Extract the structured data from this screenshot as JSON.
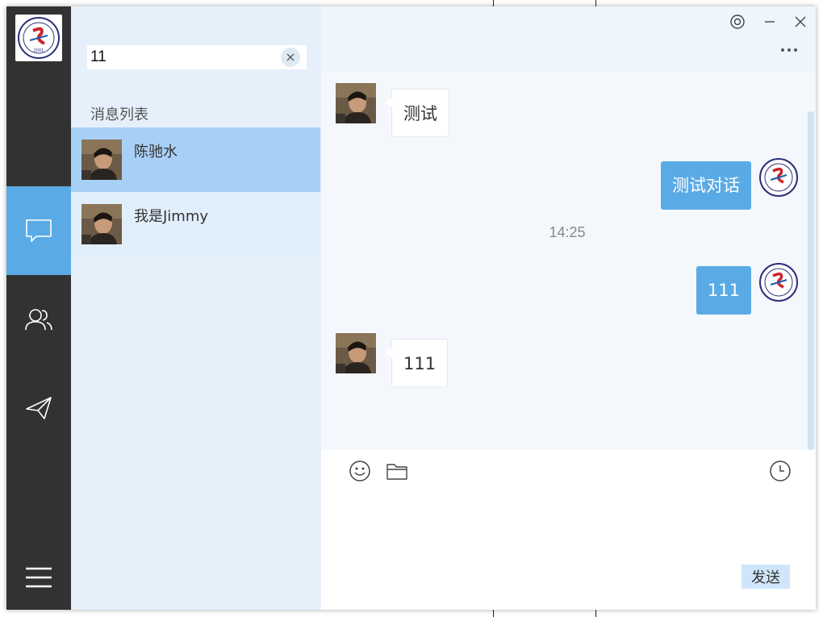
{
  "app": {
    "logo_name": "school-logo"
  },
  "colors": {
    "rail": "#323232",
    "accent": "#5aabe5",
    "list_bg": "#e6f0fa",
    "selected": "#a8d0f7",
    "chat_bg": "#f4f8fd"
  },
  "rail": {
    "items": [
      {
        "name": "chat",
        "icon": "chat-bubble-icon",
        "active": true
      },
      {
        "name": "contacts",
        "icon": "contacts-icon",
        "active": false
      },
      {
        "name": "send",
        "icon": "paper-plane-icon",
        "active": false
      }
    ],
    "menu_icon": "hamburger-menu-icon"
  },
  "search": {
    "value": "11",
    "clear_icon": "close-icon"
  },
  "list": {
    "title": "消息列表",
    "items": [
      {
        "name": "陈驰水",
        "selected": true
      },
      {
        "name": "我是Jimmy",
        "selected": false
      }
    ]
  },
  "window_controls": {
    "settings_icon": "settings-icon",
    "minimize_icon": "minimize-icon",
    "close_icon": "close-icon",
    "more_icon": "more-icon"
  },
  "messages": [
    {
      "side": "left",
      "text": "测试"
    },
    {
      "side": "right",
      "text": "测试对话"
    },
    {
      "type": "time",
      "text": "14:25"
    },
    {
      "side": "right",
      "text": "111"
    },
    {
      "side": "left",
      "text": "111"
    }
  ],
  "composer": {
    "emoji_icon": "emoji-icon",
    "folder_icon": "folder-icon",
    "history_icon": "clock-icon",
    "send_label": "发送"
  }
}
